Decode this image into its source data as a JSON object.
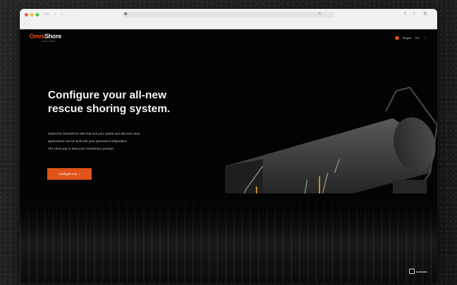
{
  "site": {
    "logo": {
      "name_part1": "Omni",
      "name_part2": "Shore",
      "tagline": "rescue shoring"
    },
    "nav": {
      "region_label": "Region",
      "language_label": "EN"
    },
    "hero": {
      "title_line1": "Configure your all-new",
      "title_line2": "rescue shoring system.",
      "description_lines": [
        "Select the OmniShore sets that suit your needs and discover what",
        "applications can be built with your personal configuration.",
        "The ideal way to start your OmniShore journey!"
      ],
      "cta_label": "Configure now",
      "cta_arrow": "›"
    },
    "brand_mark": "holmatro"
  },
  "colors": {
    "accent": "#e0541a",
    "background": "#030303",
    "chrome": "#f1f1f1"
  },
  "icons": {
    "window_controls": [
      "close-dot",
      "minimize-dot",
      "maximize-dot"
    ],
    "toolbar": [
      "sidebar-icon",
      "back-icon",
      "forward-icon",
      "shield-icon",
      "share-icon",
      "new-tab-icon",
      "tabs-icon"
    ],
    "nav": [
      "flag-icon",
      "chevron-down-icon"
    ]
  }
}
